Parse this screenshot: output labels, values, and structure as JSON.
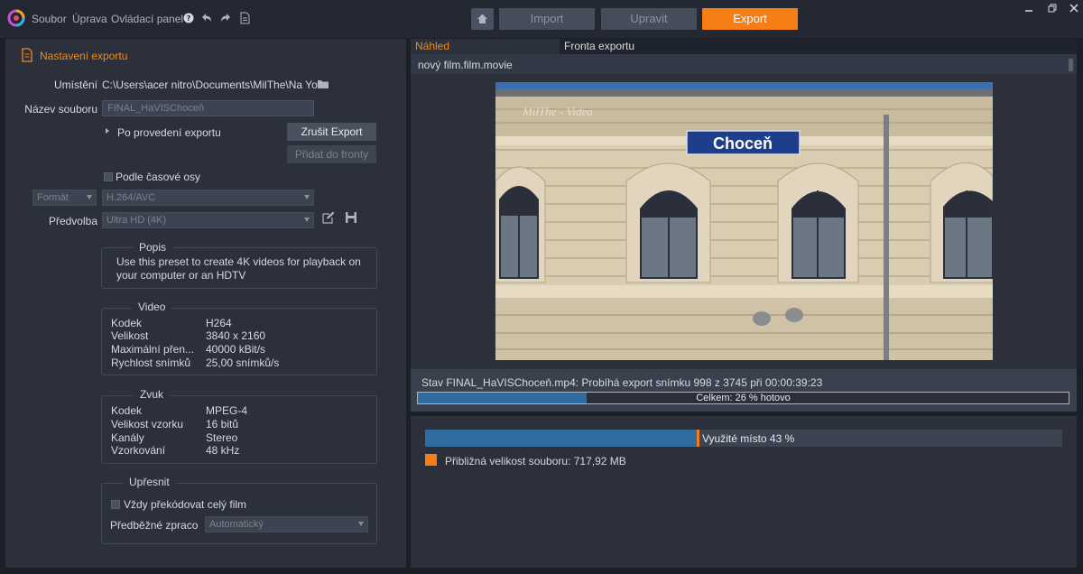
{
  "menu": {
    "items": [
      "Soubor",
      "Úprava",
      "Ovládací panel"
    ],
    "icons": [
      "help-icon",
      "undo-icon",
      "redo-icon",
      "document-icon"
    ]
  },
  "nav": {
    "import_label": "Import",
    "edit_label": "Upravit",
    "export_label": "Export"
  },
  "colors": {
    "accent": "#f57e16",
    "progress": "#2f6da1",
    "panel": "#2b303b"
  },
  "export_settings": {
    "title": "Nastavení exportu",
    "location_label": "Umístění",
    "location_value": "C:\\Users\\acer nitro\\Documents\\MilThe\\Na You...",
    "filename_label": "Název souboru",
    "filename_value": "FINAL_HaVISChoceň",
    "after_export_label": "Po provedení exportu",
    "cancel_button": "Zrušit Export",
    "queue_button": "Přidat do fronty",
    "timeline_label": "Podle časové osy",
    "format_label": "Formát",
    "format_value": "H.264/AVC",
    "preset_label": "Předvolba",
    "preset_value": "Ultra HD (4K)"
  },
  "description": {
    "title": "Popis",
    "text": "Use this preset to create 4K videos for playback on your computer or an HDTV"
  },
  "video": {
    "title": "Video",
    "rows": [
      {
        "key": "Kodek",
        "value": "H264"
      },
      {
        "key": "Velikost",
        "value": "3840 x 2160"
      },
      {
        "key": "Maximální přen...",
        "value": "40000 kBit/s"
      },
      {
        "key": "Rychlost snímků",
        "value": "25,00 snímků/s"
      }
    ]
  },
  "audio": {
    "title": "Zvuk",
    "rows": [
      {
        "key": "Kodek",
        "value": "MPEG-4"
      },
      {
        "key": "Velikost vzorku",
        "value": "16 bitů"
      },
      {
        "key": "Kanály",
        "value": "Stereo"
      },
      {
        "key": "Vzorkování",
        "value": "48 kHz"
      }
    ]
  },
  "refine": {
    "title": "Upřesnit",
    "always_transcode_label": "Vždy překódovat celý film",
    "prerender_label": "Předběžné zpraco",
    "prerender_value": "Automatický"
  },
  "preview": {
    "tab_preview": "Náhled",
    "tab_queue": "Fronta exportu",
    "filename": "nový film.film.movie",
    "sign_text": "Choceň",
    "watermark_text": "MilThe - Videa",
    "status_text": "Stav FINAL_HaVISChoceň.mp4: Probíhá export snímku 998 z 3745 při 00:00:39:23",
    "progress_label": "Celkem: 26 % hotovo",
    "progress_fraction": 0.26
  },
  "disk": {
    "usage_label": "Využité místo 43 %",
    "usage_fraction": 0.43,
    "size_label": "Přibližná velikost souboru: 717,92 MB"
  }
}
